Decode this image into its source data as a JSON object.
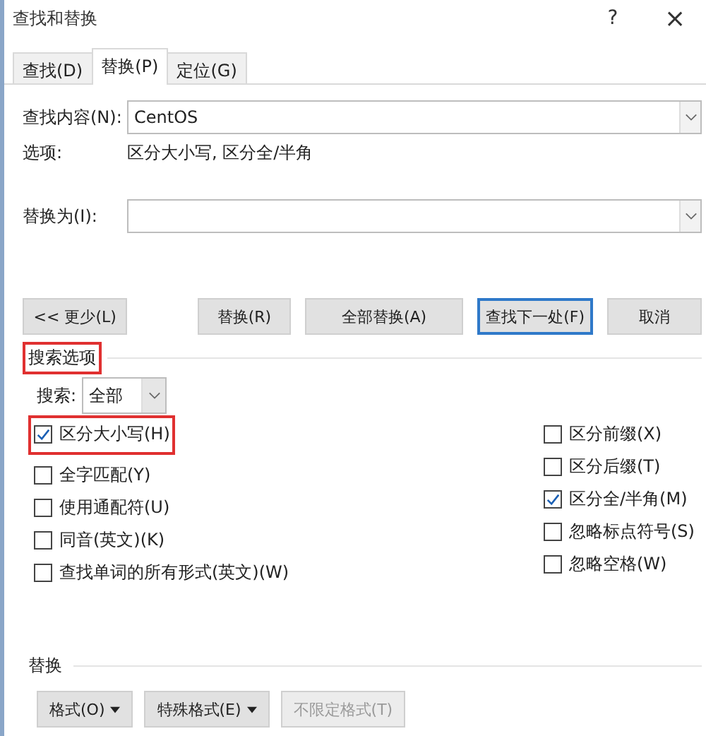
{
  "window": {
    "title": "查找和替换",
    "help": "?",
    "close": "×"
  },
  "tabs": [
    {
      "label": "查找(D)",
      "selected": false
    },
    {
      "label": "替换(P)",
      "selected": true
    },
    {
      "label": "定位(G)",
      "selected": false
    }
  ],
  "find": {
    "label": "查找内容(N):",
    "value": "CentOS"
  },
  "options": {
    "label": "选项:",
    "value": "区分大小写, 区分全/半角"
  },
  "replace": {
    "label": "替换为(I):"
  },
  "buttons": [
    {
      "label": "<< 更少(L)",
      "default": false
    },
    {
      "label": "替换(R)",
      "default": false
    },
    {
      "label": "全部替换(A)",
      "default": false
    },
    {
      "label": "查找下一处(F)",
      "default": true
    },
    {
      "label": "取消",
      "default": false
    }
  ],
  "search_options": {
    "title": "搜索选项",
    "highlighted": true,
    "search_label": "搜索:",
    "search_value": "全部"
  },
  "checks_left": [
    {
      "label": "区分大小写(H)",
      "checked": true,
      "highlighted": true
    },
    {
      "label": "全字匹配(Y)",
      "checked": false,
      "highlighted": false
    },
    {
      "label": "使用通配符(U)",
      "checked": false,
      "highlighted": false
    },
    {
      "label": "同音(英文)(K)",
      "checked": false,
      "highlighted": false
    },
    {
      "label": "查找单词的所有形式(英文)(W)",
      "checked": false,
      "highlighted": false
    }
  ],
  "checks_right": [
    {
      "label": "区分前缀(X)",
      "checked": false
    },
    {
      "label": "区分后缀(T)",
      "checked": false
    },
    {
      "label": "区分全/半角(M)",
      "checked": true
    },
    {
      "label": "忽略标点符号(S)",
      "checked": false
    },
    {
      "label": "忽略空格(W)",
      "checked": false
    }
  ],
  "replace_section": {
    "title": "替换",
    "buttons": [
      {
        "label": "格式(O)",
        "dropdown": true,
        "disabled": false
      },
      {
        "label": "特殊格式(E)",
        "dropdown": true,
        "disabled": false
      },
      {
        "label": "不限定格式(T)",
        "dropdown": false,
        "disabled": true
      }
    ]
  }
}
